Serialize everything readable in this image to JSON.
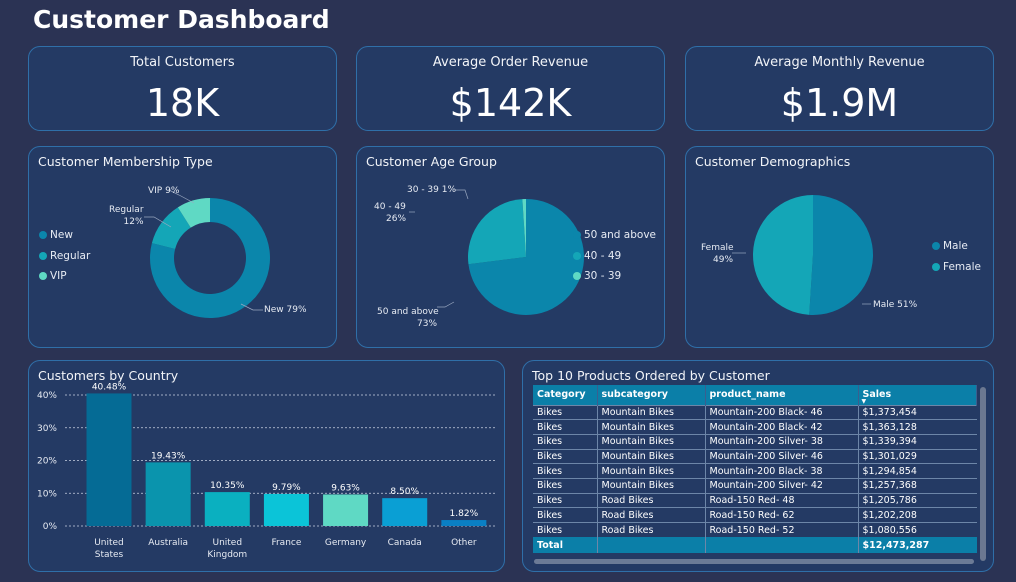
{
  "dashboard": {
    "title": "Customer Dashboard"
  },
  "kpis": [
    {
      "label": "Total Customers",
      "value": "18K"
    },
    {
      "label": "Average Order Revenue",
      "value": "$142K"
    },
    {
      "label": "Average Monthly Revenue",
      "value": "$1.9M"
    }
  ],
  "membership": {
    "title": "Customer Membership Type",
    "legend": [
      "New",
      "Regular",
      "VIP"
    ],
    "labels": {
      "new": "New 79%",
      "regular_1": "Regular",
      "regular_2": "12%",
      "vip": "VIP 9%"
    }
  },
  "age": {
    "title": "Customer Age Group",
    "legend": [
      "50 and above",
      "40 - 49",
      "30 - 39"
    ],
    "labels": {
      "a50_1": "50 and above",
      "a50_2": "73%",
      "a40_1": "40 - 49",
      "a40_2": "26%",
      "a30": "30 - 39 1%"
    }
  },
  "demographics": {
    "title": "Customer Demographics",
    "legend": [
      "Male",
      "Female"
    ],
    "labels": {
      "male": "Male 51%",
      "female_1": "Female",
      "female_2": "49%"
    }
  },
  "country": {
    "title": "Customers by Country"
  },
  "products": {
    "title": "Top 10 Products Ordered by Customer",
    "columns": [
      "Category",
      "subcategory",
      "product_name",
      "Sales"
    ],
    "rows": [
      [
        "Bikes",
        "Mountain Bikes",
        "Mountain-200 Black- 46",
        "$1,373,454"
      ],
      [
        "Bikes",
        "Mountain Bikes",
        "Mountain-200 Black- 42",
        "$1,363,128"
      ],
      [
        "Bikes",
        "Mountain Bikes",
        "Mountain-200 Silver- 38",
        "$1,339,394"
      ],
      [
        "Bikes",
        "Mountain Bikes",
        "Mountain-200 Silver- 46",
        "$1,301,029"
      ],
      [
        "Bikes",
        "Mountain Bikes",
        "Mountain-200 Black- 38",
        "$1,294,854"
      ],
      [
        "Bikes",
        "Mountain Bikes",
        "Mountain-200 Silver- 42",
        "$1,257,368"
      ],
      [
        "Bikes",
        "Road Bikes",
        "Road-150 Red- 48",
        "$1,205,786"
      ],
      [
        "Bikes",
        "Road Bikes",
        "Road-150 Red- 62",
        "$1,202,208"
      ],
      [
        "Bikes",
        "Road Bikes",
        "Road-150 Red- 52",
        "$1,080,556"
      ]
    ],
    "total_label": "Total",
    "total_value": "$12,473,287"
  },
  "colors": {
    "background": "#2b3354",
    "card": "#243a64",
    "teal_dark": "#0a7ea3",
    "teal_mid": "#0fa7b8",
    "mint": "#5fd9c4"
  },
  "chart_data": [
    {
      "type": "pie",
      "title": "Customer Membership Type",
      "variant": "donut",
      "categories": [
        "New",
        "Regular",
        "VIP"
      ],
      "values": [
        79,
        12,
        9
      ],
      "colors": [
        "#0b86ab",
        "#14a6b7",
        "#5fd9c4"
      ],
      "legend": "left"
    },
    {
      "type": "pie",
      "title": "Customer Age Group",
      "categories": [
        "50 and above",
        "40 - 49",
        "30 - 39"
      ],
      "values": [
        73,
        26,
        1
      ],
      "colors": [
        "#0b86ab",
        "#14a6b7",
        "#5fd9c4"
      ],
      "legend": "right"
    },
    {
      "type": "pie",
      "title": "Customer Demographics",
      "categories": [
        "Male",
        "Female"
      ],
      "values": [
        51,
        49
      ],
      "colors": [
        "#0b86ab",
        "#14a6b7"
      ],
      "legend": "right"
    },
    {
      "type": "bar",
      "title": "Customers by Country",
      "categories": [
        "United States",
        "Australia",
        "United Kingdom",
        "France",
        "Germany",
        "Canada",
        "Other"
      ],
      "tick_labels": [
        [
          "United",
          "States"
        ],
        [
          "Australia"
        ],
        [
          "United",
          "Kingdom"
        ],
        [
          "France"
        ],
        [
          "Germany"
        ],
        [
          "Canada"
        ],
        [
          "Other"
        ]
      ],
      "values": [
        40.48,
        19.43,
        10.35,
        9.79,
        9.63,
        8.5,
        1.82
      ],
      "data_labels": [
        "40.48%",
        "19.43%",
        "10.35%",
        "9.79%",
        "9.63%",
        "8.50%",
        "1.82%"
      ],
      "colors": [
        "#056b95",
        "#0a94ad",
        "#0ab0c0",
        "#0bc4d8",
        "#5fd9c4",
        "#0a9fd4",
        "#0a7fc4"
      ],
      "ylim": [
        0,
        40
      ],
      "yticks": [
        "0%",
        "10%",
        "20%",
        "30%",
        "40%"
      ],
      "grid": true
    }
  ]
}
